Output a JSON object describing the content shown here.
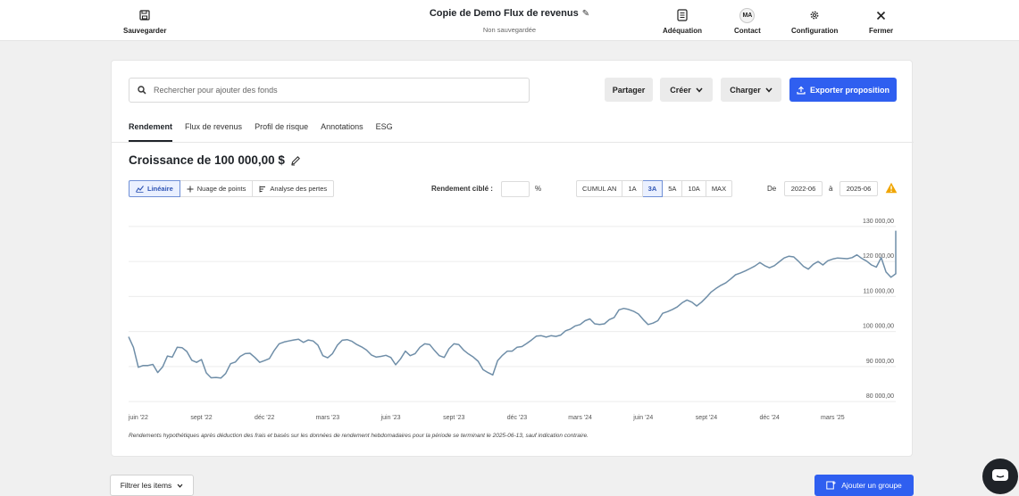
{
  "topbar": {
    "save_label": "Sauvegarder",
    "title": "Copie de Demo Flux de revenus",
    "subtitle": "Non sauvegardée",
    "adequation_label": "Adéquation",
    "contact_label": "Contact",
    "contact_initials": "MA",
    "configuration_label": "Configuration",
    "close_label": "Fermer"
  },
  "search": {
    "placeholder": "Rechercher pour ajouter des fonds",
    "value": ""
  },
  "actions": {
    "share": "Partager",
    "create": "Créer",
    "load": "Charger",
    "export": "Exporter proposition",
    "accent_color": "#2f5ff0"
  },
  "tabs": [
    {
      "label": "Rendement",
      "active": true
    },
    {
      "label": "Flux de revenus",
      "active": false
    },
    {
      "label": "Profil de risque",
      "active": false
    },
    {
      "label": "Annotations",
      "active": false
    },
    {
      "label": "ESG",
      "active": false
    }
  ],
  "section_title": "Croissance de 100 000,00 $",
  "chart_modes": [
    {
      "label": "Linéaire",
      "icon": "line-chart-icon",
      "active": true
    },
    {
      "label": "Nuage de points",
      "icon": "plus-icon",
      "active": false
    },
    {
      "label": "Analyse des pertes",
      "icon": "bars-icon",
      "active": false
    }
  ],
  "target_return": {
    "label": "Rendement ciblé :",
    "value": "",
    "unit": "%"
  },
  "periods": [
    {
      "label": "CUMUL AN",
      "active": false
    },
    {
      "label": "1A",
      "active": false
    },
    {
      "label": "3A",
      "active": true
    },
    {
      "label": "5A",
      "active": false
    },
    {
      "label": "10A",
      "active": false
    },
    {
      "label": "MAX",
      "active": false
    }
  ],
  "date_range": {
    "from_label": "De",
    "from": "2022-06",
    "to_label": "à",
    "to": "2025-06",
    "warning_color": "#f0a500"
  },
  "chart_data": {
    "type": "line",
    "line_color": "#6f8ea8",
    "grid": true,
    "ylim": [
      78000,
      132000
    ],
    "yticks": [
      {
        "value": 80000,
        "label": "80 000,00"
      },
      {
        "value": 90000,
        "label": "90 000,00"
      },
      {
        "value": 100000,
        "label": "100 000,00"
      },
      {
        "value": 110000,
        "label": "110 000,00"
      },
      {
        "value": 120000,
        "label": "120 000,00"
      },
      {
        "value": 130000,
        "label": "130 000,00"
      }
    ],
    "xticks": [
      {
        "value": "2022-06-17",
        "label": "juin '22"
      },
      {
        "value": "2022-09-16",
        "label": "sept '22"
      },
      {
        "value": "2022-12-16",
        "label": "déc '22"
      },
      {
        "value": "2023-03-17",
        "label": "mars '23"
      },
      {
        "value": "2023-06-16",
        "label": "juin '23"
      },
      {
        "value": "2023-09-15",
        "label": "sept '23"
      },
      {
        "value": "2023-12-15",
        "label": "déc '23"
      },
      {
        "value": "2024-03-15",
        "label": "mars '24"
      },
      {
        "value": "2024-06-14",
        "label": "juin '24"
      },
      {
        "value": "2024-09-13",
        "label": "sept '24"
      },
      {
        "value": "2024-12-13",
        "label": "déc '24"
      },
      {
        "value": "2025-03-14",
        "label": "mars '25"
      }
    ],
    "x_start": "2022-06-03",
    "x_end": "2025-06-13",
    "x_step_weeks": 1,
    "values": [
      98500,
      95500,
      89800,
      90300,
      90300,
      90600,
      88300,
      89900,
      93000,
      92700,
      95500,
      95400,
      94300,
      91800,
      91200,
      92000,
      88200,
      86800,
      86900,
      86700,
      88000,
      90800,
      91300,
      92900,
      93700,
      93800,
      92600,
      91200,
      91700,
      92300,
      94600,
      96500,
      97000,
      97300,
      97600,
      97800,
      96900,
      97600,
      97300,
      96100,
      93100,
      92500,
      93700,
      96100,
      97500,
      97700,
      97200,
      96300,
      95600,
      94700,
      93300,
      92700,
      92900,
      93200,
      92600,
      90500,
      92200,
      94400,
      93100,
      93700,
      95500,
      96500,
      96300,
      94600,
      93100,
      92600,
      95100,
      96500,
      96300,
      94700,
      93600,
      92700,
      91500,
      89100,
      88300,
      87600,
      91700,
      93200,
      94400,
      94400,
      95500,
      95700,
      96600,
      97600,
      98700,
      98800,
      98400,
      98800,
      98600,
      99000,
      100200,
      100700,
      101600,
      102000,
      103100,
      103600,
      102200,
      102000,
      102200,
      103400,
      104000,
      106200,
      106600,
      106300,
      105800,
      105000,
      103400,
      102000,
      102400,
      103100,
      105200,
      105700,
      106300,
      107000,
      108200,
      109000,
      108400,
      107300,
      108400,
      109800,
      111300,
      112300,
      113200,
      113900,
      115000,
      116200,
      116700,
      117300,
      118000,
      118700,
      119700,
      118800,
      118200,
      118800,
      119900,
      121000,
      121500,
      121300,
      120000,
      118600,
      117800,
      119200,
      120000,
      119000,
      120200,
      120700,
      121000,
      120900,
      120800,
      121100,
      121900,
      120900,
      120100,
      119000,
      118400,
      121100,
      117000,
      115500,
      116500,
      119300,
      120600,
      122000,
      123500,
      124000,
      125400,
      126000,
      126600,
      127200,
      128000,
      128800
    ]
  },
  "footnote": "Rendements hypothétiques après déduction des frais et basés sur les données de rendement hebdomadaires pour la période se terminant le 2025-06-13, sauf indication contraire.",
  "bottom": {
    "filter_label": "Filtrer les items",
    "add_group_label": "Ajouter un groupe"
  }
}
